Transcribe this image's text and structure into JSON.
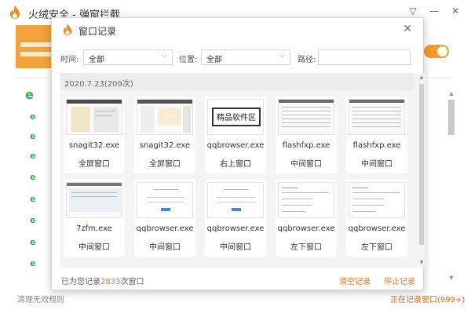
{
  "app": {
    "title": "火绒安全 - 弹窗拦截",
    "menu_icon": "menu-chevron-icon",
    "footer_left": "清理无效规则",
    "footer_right": "正在记录窗口(999+)",
    "accent": "#f39a2a"
  },
  "dialog": {
    "title": "窗口记录",
    "close_icon": "close-icon",
    "filters": {
      "time_label": "时间:",
      "time_value": "全部",
      "position_label": "位置:",
      "position_value": "全部",
      "path_label": "路径:",
      "path_value": ""
    },
    "group_date": "2020.7.23(209次)",
    "cards": [
      {
        "name": "snagit32.exe",
        "position": "全屏窗口"
      },
      {
        "name": "snagit32.exe",
        "position": "全屏窗口"
      },
      {
        "name": "qqbrowser.exe",
        "position": "右上窗口",
        "thumb_text": "精品软件区"
      },
      {
        "name": "flashfxp.exe",
        "position": "中间窗口"
      },
      {
        "name": "flashfxp.exe",
        "position": "中间窗口"
      },
      {
        "name": "7zfm.exe",
        "position": "中间窗口"
      },
      {
        "name": "qqbrowser.exe",
        "position": "中间窗口"
      },
      {
        "name": "qqbrowser.exe",
        "position": "中间窗口"
      },
      {
        "name": "qqbrowser.exe",
        "position": "左下窗口"
      },
      {
        "name": "qqbrowser.exe",
        "position": "左下窗口"
      }
    ],
    "footer": {
      "prefix": "已为您记录",
      "count": "2833",
      "suffix": "次窗口",
      "clear_label": "清空记录",
      "stop_label": "停止记录"
    }
  }
}
